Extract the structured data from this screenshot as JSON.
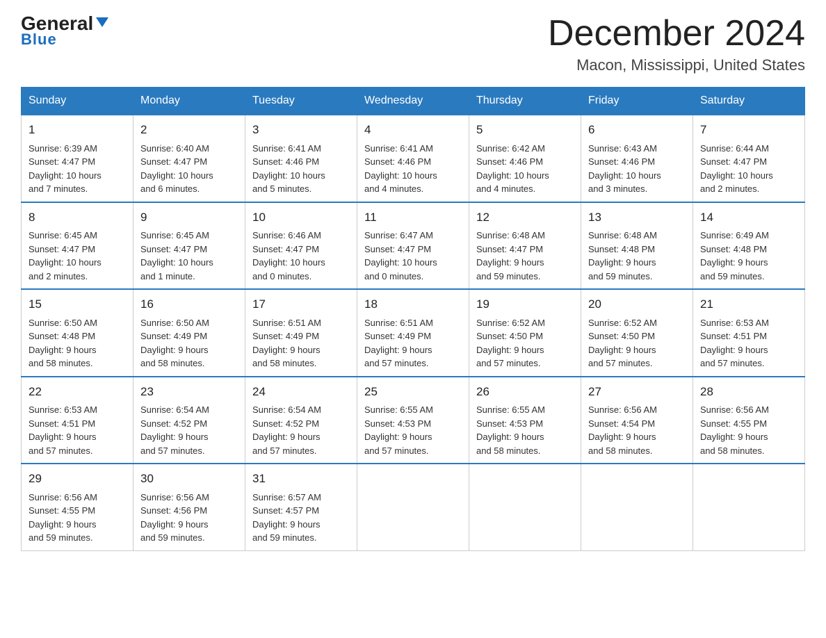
{
  "header": {
    "logo_text_general": "General",
    "logo_text_blue": "Blue",
    "month_title": "December 2024",
    "location": "Macon, Mississippi, United States"
  },
  "weekdays": [
    "Sunday",
    "Monday",
    "Tuesday",
    "Wednesday",
    "Thursday",
    "Friday",
    "Saturday"
  ],
  "weeks": [
    [
      {
        "day": "1",
        "info": "Sunrise: 6:39 AM\nSunset: 4:47 PM\nDaylight: 10 hours\nand 7 minutes."
      },
      {
        "day": "2",
        "info": "Sunrise: 6:40 AM\nSunset: 4:47 PM\nDaylight: 10 hours\nand 6 minutes."
      },
      {
        "day": "3",
        "info": "Sunrise: 6:41 AM\nSunset: 4:46 PM\nDaylight: 10 hours\nand 5 minutes."
      },
      {
        "day": "4",
        "info": "Sunrise: 6:41 AM\nSunset: 4:46 PM\nDaylight: 10 hours\nand 4 minutes."
      },
      {
        "day": "5",
        "info": "Sunrise: 6:42 AM\nSunset: 4:46 PM\nDaylight: 10 hours\nand 4 minutes."
      },
      {
        "day": "6",
        "info": "Sunrise: 6:43 AM\nSunset: 4:46 PM\nDaylight: 10 hours\nand 3 minutes."
      },
      {
        "day": "7",
        "info": "Sunrise: 6:44 AM\nSunset: 4:47 PM\nDaylight: 10 hours\nand 2 minutes."
      }
    ],
    [
      {
        "day": "8",
        "info": "Sunrise: 6:45 AM\nSunset: 4:47 PM\nDaylight: 10 hours\nand 2 minutes."
      },
      {
        "day": "9",
        "info": "Sunrise: 6:45 AM\nSunset: 4:47 PM\nDaylight: 10 hours\nand 1 minute."
      },
      {
        "day": "10",
        "info": "Sunrise: 6:46 AM\nSunset: 4:47 PM\nDaylight: 10 hours\nand 0 minutes."
      },
      {
        "day": "11",
        "info": "Sunrise: 6:47 AM\nSunset: 4:47 PM\nDaylight: 10 hours\nand 0 minutes."
      },
      {
        "day": "12",
        "info": "Sunrise: 6:48 AM\nSunset: 4:47 PM\nDaylight: 9 hours\nand 59 minutes."
      },
      {
        "day": "13",
        "info": "Sunrise: 6:48 AM\nSunset: 4:48 PM\nDaylight: 9 hours\nand 59 minutes."
      },
      {
        "day": "14",
        "info": "Sunrise: 6:49 AM\nSunset: 4:48 PM\nDaylight: 9 hours\nand 59 minutes."
      }
    ],
    [
      {
        "day": "15",
        "info": "Sunrise: 6:50 AM\nSunset: 4:48 PM\nDaylight: 9 hours\nand 58 minutes."
      },
      {
        "day": "16",
        "info": "Sunrise: 6:50 AM\nSunset: 4:49 PM\nDaylight: 9 hours\nand 58 minutes."
      },
      {
        "day": "17",
        "info": "Sunrise: 6:51 AM\nSunset: 4:49 PM\nDaylight: 9 hours\nand 58 minutes."
      },
      {
        "day": "18",
        "info": "Sunrise: 6:51 AM\nSunset: 4:49 PM\nDaylight: 9 hours\nand 57 minutes."
      },
      {
        "day": "19",
        "info": "Sunrise: 6:52 AM\nSunset: 4:50 PM\nDaylight: 9 hours\nand 57 minutes."
      },
      {
        "day": "20",
        "info": "Sunrise: 6:52 AM\nSunset: 4:50 PM\nDaylight: 9 hours\nand 57 minutes."
      },
      {
        "day": "21",
        "info": "Sunrise: 6:53 AM\nSunset: 4:51 PM\nDaylight: 9 hours\nand 57 minutes."
      }
    ],
    [
      {
        "day": "22",
        "info": "Sunrise: 6:53 AM\nSunset: 4:51 PM\nDaylight: 9 hours\nand 57 minutes."
      },
      {
        "day": "23",
        "info": "Sunrise: 6:54 AM\nSunset: 4:52 PM\nDaylight: 9 hours\nand 57 minutes."
      },
      {
        "day": "24",
        "info": "Sunrise: 6:54 AM\nSunset: 4:52 PM\nDaylight: 9 hours\nand 57 minutes."
      },
      {
        "day": "25",
        "info": "Sunrise: 6:55 AM\nSunset: 4:53 PM\nDaylight: 9 hours\nand 57 minutes."
      },
      {
        "day": "26",
        "info": "Sunrise: 6:55 AM\nSunset: 4:53 PM\nDaylight: 9 hours\nand 58 minutes."
      },
      {
        "day": "27",
        "info": "Sunrise: 6:56 AM\nSunset: 4:54 PM\nDaylight: 9 hours\nand 58 minutes."
      },
      {
        "day": "28",
        "info": "Sunrise: 6:56 AM\nSunset: 4:55 PM\nDaylight: 9 hours\nand 58 minutes."
      }
    ],
    [
      {
        "day": "29",
        "info": "Sunrise: 6:56 AM\nSunset: 4:55 PM\nDaylight: 9 hours\nand 59 minutes."
      },
      {
        "day": "30",
        "info": "Sunrise: 6:56 AM\nSunset: 4:56 PM\nDaylight: 9 hours\nand 59 minutes."
      },
      {
        "day": "31",
        "info": "Sunrise: 6:57 AM\nSunset: 4:57 PM\nDaylight: 9 hours\nand 59 minutes."
      },
      null,
      null,
      null,
      null
    ]
  ]
}
